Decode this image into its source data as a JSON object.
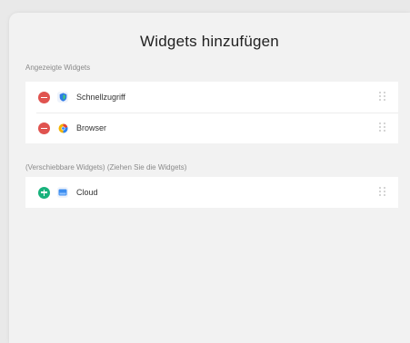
{
  "header": {
    "title": "Widgets hinzufügen"
  },
  "displayed": {
    "label": "Angezeigte Widgets",
    "items": [
      {
        "name": "Schnellzugriff",
        "action": "remove",
        "icon": "shield-icon"
      },
      {
        "name": "Browser",
        "action": "remove",
        "icon": "browser-icon"
      }
    ]
  },
  "available": {
    "label": "(Verschiebbare Widgets) (Ziehen Sie die Widgets)",
    "items": [
      {
        "name": "Cloud",
        "action": "add",
        "icon": "cloud-icon"
      }
    ]
  },
  "colors": {
    "remove": "#e0534f",
    "add": "#18b27c",
    "background": "#f2f2f2"
  }
}
